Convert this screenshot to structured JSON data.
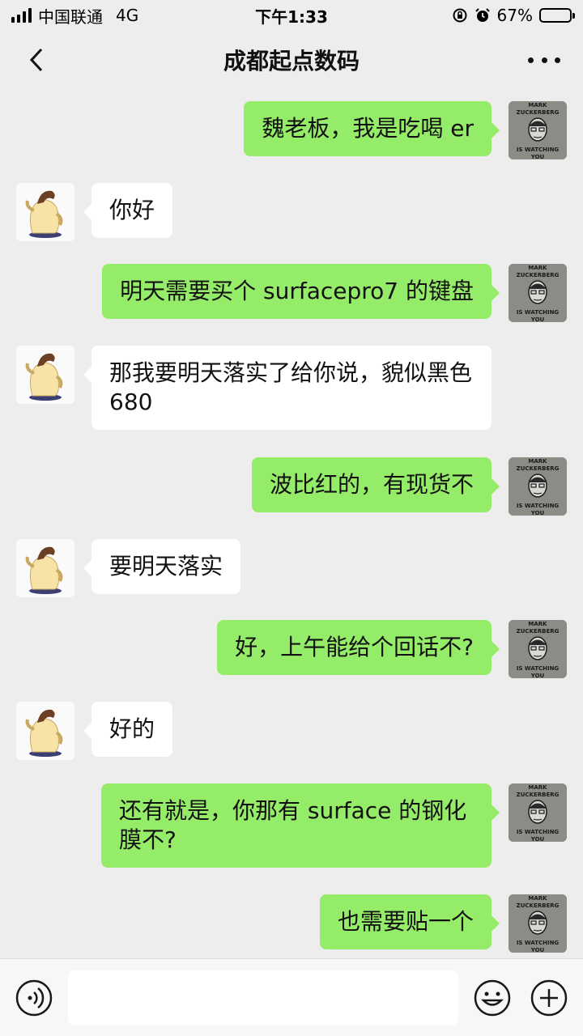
{
  "status_bar": {
    "carrier": "中国联通",
    "network": "4G",
    "time": "下午1:33",
    "battery_percent_label": "67%",
    "battery_level": 0.67
  },
  "nav": {
    "title": "成都起点数码",
    "back_icon": "chevron-left-icon",
    "more_icon": "more-dots-icon"
  },
  "messages": [
    {
      "side": "out",
      "text": "魏老板，我是吃喝 er"
    },
    {
      "side": "in",
      "text": "你好"
    },
    {
      "side": "out",
      "text": "明天需要买个 surfacepro7 的键盘"
    },
    {
      "side": "in",
      "text": "那我要明天落实了给你说，貌似黑色 680"
    },
    {
      "side": "out",
      "text": "波比红的，有现货不"
    },
    {
      "side": "in",
      "text": "要明天落实"
    },
    {
      "side": "out",
      "text": "好，上午能给个回话不?"
    },
    {
      "side": "in",
      "text": "好的"
    },
    {
      "side": "out",
      "text": "还有就是，你那有 surface 的钢化膜不?"
    },
    {
      "side": "out",
      "text": "也需要贴一个"
    }
  ],
  "avatars": {
    "out_text_top": "MARK",
    "out_text_mid": "ZUCKERBERG",
    "out_text_bottom": "IS WATCHING",
    "out_text_last": "YOU"
  },
  "colors": {
    "outgoing_bubble": "#95ec69",
    "incoming_bubble": "#ffffff",
    "background": "#ededed"
  },
  "input_bar": {
    "value": "",
    "voice_icon": "voice-icon",
    "emoji_icon": "emoji-icon",
    "plus_icon": "plus-icon"
  }
}
